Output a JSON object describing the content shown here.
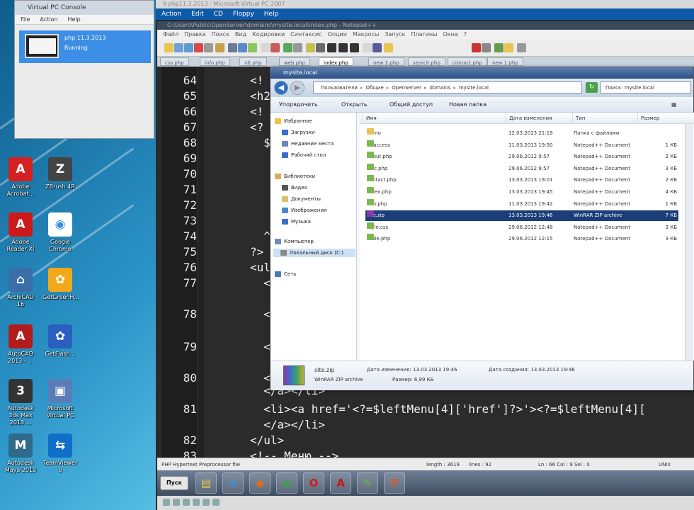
{
  "host": {
    "title": "9 php11.3.2013 - Microsoft Virtual PC 2007",
    "menu": [
      "Action",
      "Edit",
      "CD",
      "Floppy",
      "Help"
    ]
  },
  "console": {
    "title": "Virtual PC Console",
    "menu": [
      "File",
      "Action",
      "Help"
    ],
    "vm": {
      "name": "php 11.3.2013",
      "status": "Running"
    }
  },
  "desktop_icons": [
    {
      "label": "Adobe Acrobat...",
      "color": "#d42020",
      "glyph": "A"
    },
    {
      "label": "ZBrush 4R",
      "color": "#444444",
      "glyph": "Z"
    },
    {
      "label": "Adobe Reader XI",
      "color": "#cc1a1a",
      "glyph": "A"
    },
    {
      "label": "Google Chrome",
      "color": "#ffffff",
      "glyph": "◉"
    },
    {
      "label": "ArchiCAD 16",
      "color": "#3a6ea8",
      "glyph": "⌂"
    },
    {
      "label": "GetGreenH...",
      "color": "#f2a81a",
      "glyph": "✿"
    },
    {
      "label": "AutoCAD 2013 - ...",
      "color": "#b01c1c",
      "glyph": "A"
    },
    {
      "label": "GetFlash...",
      "color": "#2a5fc0",
      "glyph": "✿"
    },
    {
      "label": "Autodesk 3ds Max 2013 ...",
      "color": "#333333",
      "glyph": "3"
    },
    {
      "label": "Microsoft Virtual PC",
      "color": "#5a7db8",
      "glyph": "▣"
    },
    {
      "label": "Autodesk Maya 2013",
      "color": "#2f6a8a",
      "glyph": "M"
    },
    {
      "label": "TeamViewer 8",
      "color": "#0e6ec8",
      "glyph": "⇆"
    }
  ],
  "editor": {
    "title": "C:\\Users\\Public\\OpenServer\\domains\\mysite.local\\index.php - Notepad++",
    "menu": [
      "Файл",
      "Правка",
      "Поиск",
      "Вид",
      "Кодировки",
      "Синтаксис",
      "Опции",
      "Макросы",
      "Запуск",
      "Плагины",
      "Окна",
      "?"
    ],
    "tabs": [
      "css.php",
      "info.php",
      "alt.php",
      "web.php",
      "index.php",
      "new 2.php",
      "search.php",
      "contact.php",
      "new 1.php"
    ],
    "active_tab": "index.php",
    "lines": [
      {
        "n": "64",
        "code": "<!"
      },
      {
        "n": "65",
        "code": "<h2"
      },
      {
        "n": "66",
        "code": "<!"
      },
      {
        "n": "67",
        "code": "<?"
      },
      {
        "n": "68",
        "code": "  $"
      },
      {
        "n": "69",
        "code": ""
      },
      {
        "n": "70",
        "code": ""
      },
      {
        "n": "71",
        "code": ""
      },
      {
        "n": "72",
        "code": ""
      },
      {
        "n": "73",
        "code": ""
      },
      {
        "n": "74",
        "code": "  ^"
      },
      {
        "n": "75",
        "code": "?>"
      },
      {
        "n": "76",
        "code": "<ul"
      },
      {
        "n": "77",
        "code": "  <"
      },
      {
        "n": "78",
        "code": "  <"
      },
      {
        "n": "79",
        "code": "  <"
      },
      {
        "n": "80",
        "code": "  <"
      },
      {
        "n": "",
        "code": "  </a></li>"
      },
      {
        "n": "81",
        "code": "  <li><a href='<?=$leftMenu[4]['href']?>'><?=$leftMenu[4]["
      },
      {
        "n": "",
        "code": "  </a></li>"
      },
      {
        "n": "82",
        "code": "</ul>"
      },
      {
        "n": "83",
        "code": "<!-- Меню -->"
      }
    ],
    "status": {
      "lang": "PHP Hypertext Preprocessor file",
      "length": "length : 3619",
      "lines": "lines : 92",
      "pos": "Ln : 66    Col : 9    Sel : 0",
      "eol": "UNIX"
    }
  },
  "taskbar": {
    "start_label": "Пуск",
    "apps": [
      {
        "name": "explorer",
        "color": "#e8c450",
        "glyph": "▤"
      },
      {
        "name": "ie",
        "color": "#3a8ee0",
        "glyph": "e"
      },
      {
        "name": "firefox",
        "color": "#e2701c",
        "glyph": "◉"
      },
      {
        "name": "chrome",
        "color": "#3fa04a",
        "glyph": "◉"
      },
      {
        "name": "opera",
        "color": "#d41a1a",
        "glyph": "O"
      },
      {
        "name": "acrobat",
        "color": "#c31a1a",
        "glyph": "A"
      },
      {
        "name": "notepadpp",
        "color": "#6dbb3a",
        "glyph": "✎"
      },
      {
        "name": "powerpoint",
        "color": "#d45a2a",
        "glyph": "P"
      }
    ]
  },
  "explorer": {
    "title": "mysite.local",
    "path": [
      "Пользователи",
      "Общие",
      "OpenServer",
      "domains",
      "mysite.local"
    ],
    "search_placeholder": "Поиск: mysite.local",
    "commands": [
      "Упорядочить",
      "Открыть",
      "Общий доступ",
      "Новая папка"
    ],
    "nav": [
      {
        "label": "Избранное",
        "kind": "header",
        "color": "#f0c040"
      },
      {
        "label": "Загрузки",
        "kind": "item",
        "color": "#3a6ec8"
      },
      {
        "label": "Недавние места",
        "kind": "item",
        "color": "#6a8ab8"
      },
      {
        "label": "Рабочий стол",
        "kind": "item",
        "color": "#3a6ec8"
      },
      {
        "label": "Библиотеки",
        "kind": "header",
        "color": "#d8b050"
      },
      {
        "label": "Видео",
        "kind": "item",
        "color": "#555"
      },
      {
        "label": "Документы",
        "kind": "item",
        "color": "#d8c070"
      },
      {
        "label": "Изображения",
        "kind": "item",
        "color": "#4a88c8"
      },
      {
        "label": "Музыка",
        "kind": "item",
        "color": "#3a6ec8"
      },
      {
        "label": "Компьютер",
        "kind": "header",
        "color": "#6a8ab8"
      },
      {
        "label": "Локальный диск (C:)",
        "kind": "selected",
        "color": "#888"
      },
      {
        "label": "Сеть",
        "kind": "header",
        "color": "#4a78b8"
      }
    ],
    "columns": [
      "Имя",
      "Дата изменения",
      "Тип",
      "Размер"
    ],
    "files": [
      {
        "name": "demo",
        "date": "12.03.2013 21:19",
        "type": "Папка с файлами",
        "size": "",
        "icon": "#e8c450"
      },
      {
        "name": ".htaccess",
        "date": "11.03.2013 19:50",
        "type": "Notepad++ Document",
        "size": "1 КБ",
        "icon": "#7cb850"
      },
      {
        "name": "about.php",
        "date": "29.06.2012 9:57",
        "type": "Notepad++ Document",
        "size": "2 КБ",
        "icon": "#7cb850"
      },
      {
        "name": "calc.php",
        "date": "29.06.2012 9:57",
        "type": "Notepad++ Document",
        "size": "3 КБ",
        "icon": "#7cb850"
      },
      {
        "name": "contact.php",
        "date": "13.03.2013 19:01",
        "type": "Notepad++ Document",
        "size": "2 КБ",
        "icon": "#7cb850"
      },
      {
        "name": "index.php",
        "date": "13.03.2013 19:45",
        "type": "Notepad++ Document",
        "size": "4 КБ",
        "icon": "#7cb850"
      },
      {
        "name": "info.php",
        "date": "11.03.2013 19:42",
        "type": "Notepad++ Document",
        "size": "1 КБ",
        "icon": "#7cb850"
      },
      {
        "name": "site.zip",
        "date": "13.03.2013 19:46",
        "type": "WinRAR ZIP archive",
        "size": "7 КБ",
        "icon": "#8a3aa8",
        "selected": true
      },
      {
        "name": "style.css",
        "date": "29.06.2012 12:48",
        "type": "Notepad++ Document",
        "size": "3 КБ",
        "icon": "#7cb850"
      },
      {
        "name": "table.php",
        "date": "29.06.2012 12:15",
        "type": "Notepad++ Document",
        "size": "3 КБ",
        "icon": "#7cb850"
      }
    ],
    "details": {
      "name": "site.zip",
      "type": "WinRAR ZIP archive",
      "modified": "Дата изменения: 13.03.2013 19:46",
      "created": "Дата создания: 13.03.2013 19:46",
      "size": "Размер: 6,99 КБ"
    }
  }
}
